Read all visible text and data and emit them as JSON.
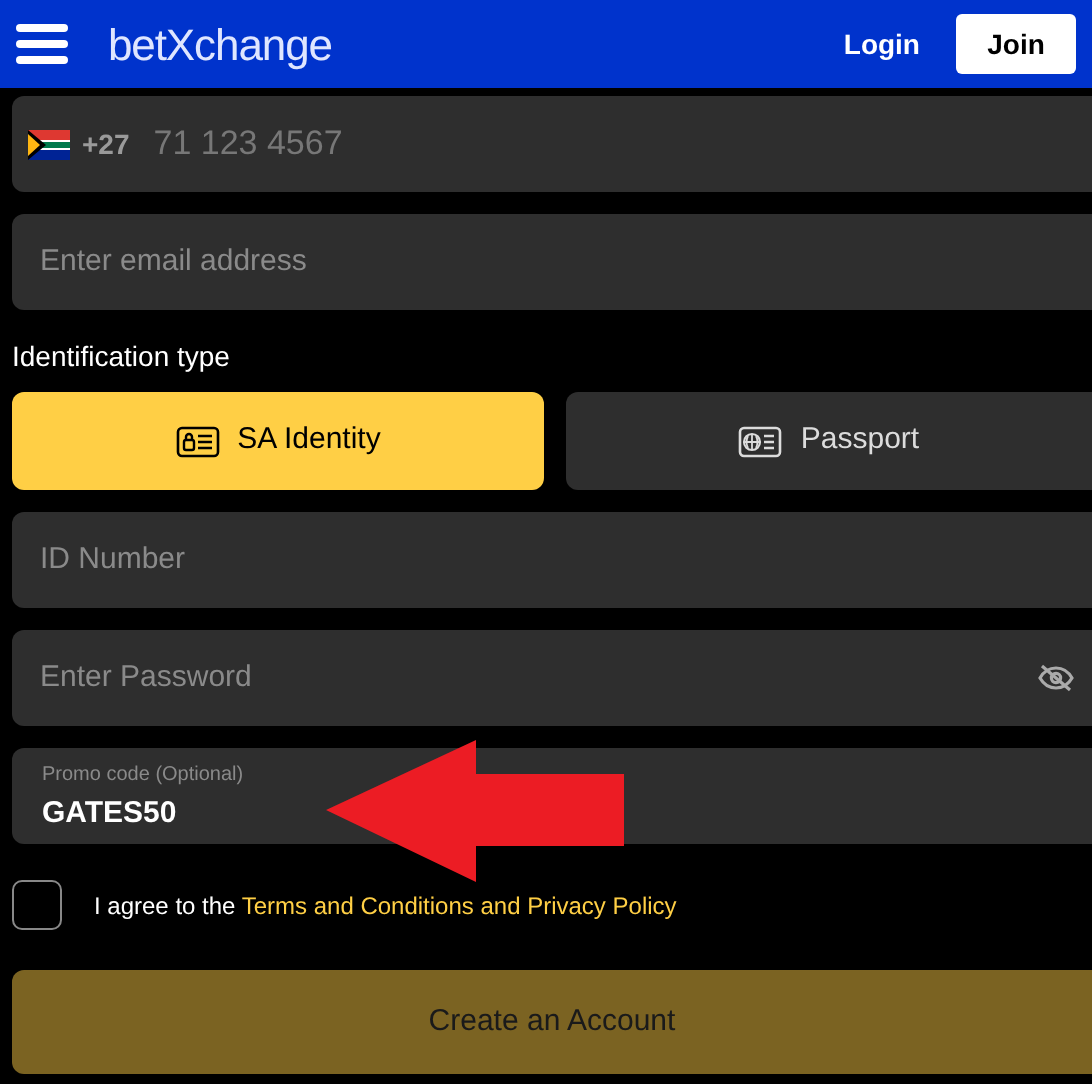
{
  "header": {
    "logo": "betXchange",
    "login": "Login",
    "join": "Join"
  },
  "phone": {
    "code": "+27",
    "placeholder": "71 123 4567"
  },
  "email": {
    "placeholder": "Enter email address"
  },
  "identification": {
    "label": "Identification type",
    "tabs": [
      {
        "label": "SA Identity",
        "kind": "id-card",
        "selected": true
      },
      {
        "label": "Passport",
        "kind": "passport",
        "selected": false
      }
    ]
  },
  "id_number": {
    "placeholder": "ID Number"
  },
  "password": {
    "placeholder": "Enter Password"
  },
  "promo": {
    "label": "Promo code (Optional)",
    "value": "GATES50"
  },
  "agreement": {
    "checked": false,
    "text": "I agree to the ",
    "link": "Terms and Conditions and Privacy Policy"
  },
  "submit": "Create an Account"
}
